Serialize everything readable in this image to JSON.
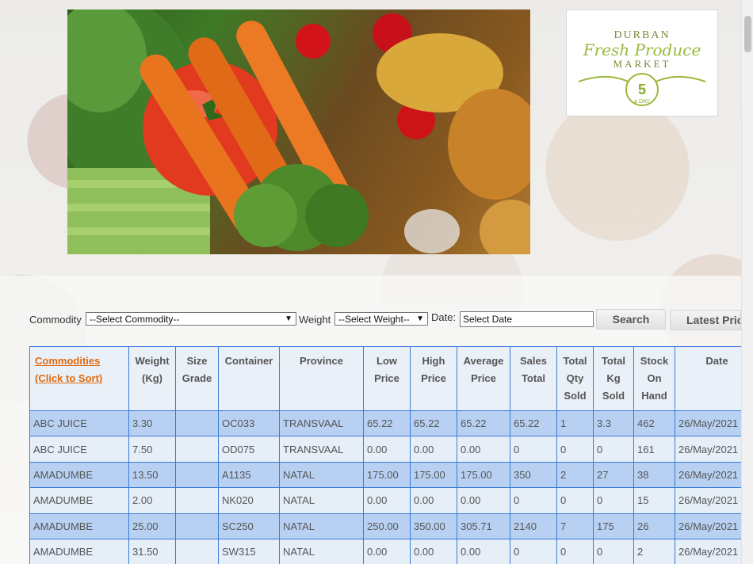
{
  "logo": {
    "line1": "DURBAN",
    "line2": "Fresh Produce",
    "line3": "MARKET",
    "badge": "5",
    "badge_sub": "a DAY"
  },
  "search": {
    "commodity_label": "Commodity",
    "commodity_value": "--Select Commodity--",
    "weight_label": "Weight",
    "weight_value": "--Select Weight--",
    "date_label": "Date:",
    "date_value": "Select Date",
    "search_button": "Search",
    "latest_button": "Latest Prices"
  },
  "table": {
    "sort_line1": "Commodities",
    "sort_line2": "(Click to Sort)",
    "headers": [
      [
        "Weight",
        "(Kg)"
      ],
      [
        "Size",
        "Grade"
      ],
      [
        "Container"
      ],
      [
        "Province"
      ],
      [
        "Low",
        "Price"
      ],
      [
        "High",
        "Price"
      ],
      [
        "Average",
        "Price"
      ],
      [
        "Sales",
        "Total"
      ],
      [
        "Total",
        "Qty",
        "Sold"
      ],
      [
        "Total",
        "Kg",
        "Sold"
      ],
      [
        "Stock",
        "On",
        "Hand"
      ],
      [
        "Date"
      ]
    ],
    "rows": [
      [
        "ABC JUICE",
        "3.30",
        "",
        "OC033",
        "TRANSVAAL",
        "65.22",
        "65.22",
        "65.22",
        "65.22",
        "1",
        "3.3",
        "462",
        "26/May/2021"
      ],
      [
        "ABC JUICE",
        "7.50",
        "",
        "OD075",
        "TRANSVAAL",
        "0.00",
        "0.00",
        "0.00",
        "0",
        "0",
        "0",
        "161",
        "26/May/2021"
      ],
      [
        "AMADUMBE",
        "13.50",
        "",
        "A1135",
        "NATAL",
        "175.00",
        "175.00",
        "175.00",
        "350",
        "2",
        "27",
        "38",
        "26/May/2021"
      ],
      [
        "AMADUMBE",
        "2.00",
        "",
        "NK020",
        "NATAL",
        "0.00",
        "0.00",
        "0.00",
        "0",
        "0",
        "0",
        "15",
        "26/May/2021"
      ],
      [
        "AMADUMBE",
        "25.00",
        "",
        "SC250",
        "NATAL",
        "250.00",
        "350.00",
        "305.71",
        "2140",
        "7",
        "175",
        "26",
        "26/May/2021"
      ],
      [
        "AMADUMBE",
        "31.50",
        "",
        "SW315",
        "NATAL",
        "0.00",
        "0.00",
        "0.00",
        "0",
        "0",
        "0",
        "2",
        "26/May/2021"
      ]
    ]
  }
}
